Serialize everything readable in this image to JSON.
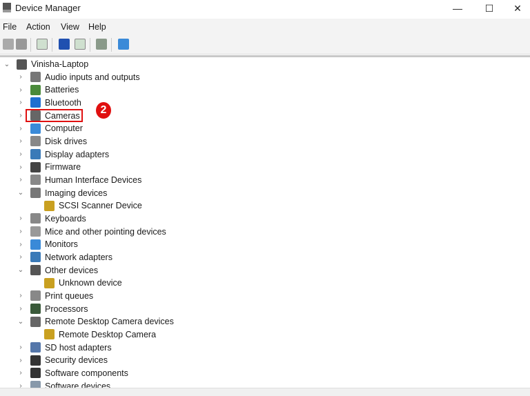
{
  "window": {
    "title": "Device Manager",
    "minimize": "—",
    "maximize": "☐",
    "close": "✕"
  },
  "menu": [
    "File",
    "Action",
    "View",
    "Help"
  ],
  "toolbar": [
    "back-icon",
    "forward-icon",
    "show-hide-console-tree-icon",
    "help-icon",
    "properties-icon",
    "update-driver-icon",
    "scan-hardware-icon"
  ],
  "tree": [
    {
      "label": "Vinisha-Laptop",
      "level": 0,
      "expanded": true,
      "color": "#555"
    },
    {
      "label": "Audio inputs and outputs",
      "level": 1,
      "color": "#777"
    },
    {
      "label": "Batteries",
      "level": 1,
      "color": "#4a8a3a"
    },
    {
      "label": "Bluetooth",
      "level": 1,
      "color": "#1f6fd0"
    },
    {
      "label": "Cameras",
      "level": 1,
      "color": "#666"
    },
    {
      "label": "Computer",
      "level": 1,
      "color": "#3a8ad8"
    },
    {
      "label": "Disk drives",
      "level": 1,
      "color": "#888"
    },
    {
      "label": "Display adapters",
      "level": 1,
      "color": "#3a7ab8"
    },
    {
      "label": "Firmware",
      "level": 1,
      "color": "#444"
    },
    {
      "label": "Human Interface Devices",
      "level": 1,
      "color": "#888"
    },
    {
      "label": "Imaging devices",
      "level": 1,
      "expanded": true,
      "color": "#777"
    },
    {
      "label": "SCSI Scanner Device",
      "level": 2,
      "color": "#c9a020"
    },
    {
      "label": "Keyboards",
      "level": 1,
      "color": "#888"
    },
    {
      "label": "Mice and other pointing devices",
      "level": 1,
      "color": "#999"
    },
    {
      "label": "Monitors",
      "level": 1,
      "color": "#3a8ad8"
    },
    {
      "label": "Network adapters",
      "level": 1,
      "color": "#3a7ab8"
    },
    {
      "label": "Other devices",
      "level": 1,
      "expanded": true,
      "color": "#555"
    },
    {
      "label": "Unknown device",
      "level": 2,
      "color": "#c9a020"
    },
    {
      "label": "Print queues",
      "level": 1,
      "color": "#888"
    },
    {
      "label": "Processors",
      "level": 1,
      "color": "#3a5a3a"
    },
    {
      "label": "Remote Desktop Camera devices",
      "level": 1,
      "expanded": true,
      "color": "#666"
    },
    {
      "label": "Remote Desktop Camera",
      "level": 2,
      "color": "#c9a020"
    },
    {
      "label": "SD host adapters",
      "level": 1,
      "color": "#5577aa"
    },
    {
      "label": "Security devices",
      "level": 1,
      "color": "#333"
    },
    {
      "label": "Software components",
      "level": 1,
      "color": "#333"
    },
    {
      "label": "Software devices",
      "level": 1,
      "color": "#8899aa"
    }
  ],
  "annotation": {
    "step": "2",
    "color": "#e01010"
  }
}
